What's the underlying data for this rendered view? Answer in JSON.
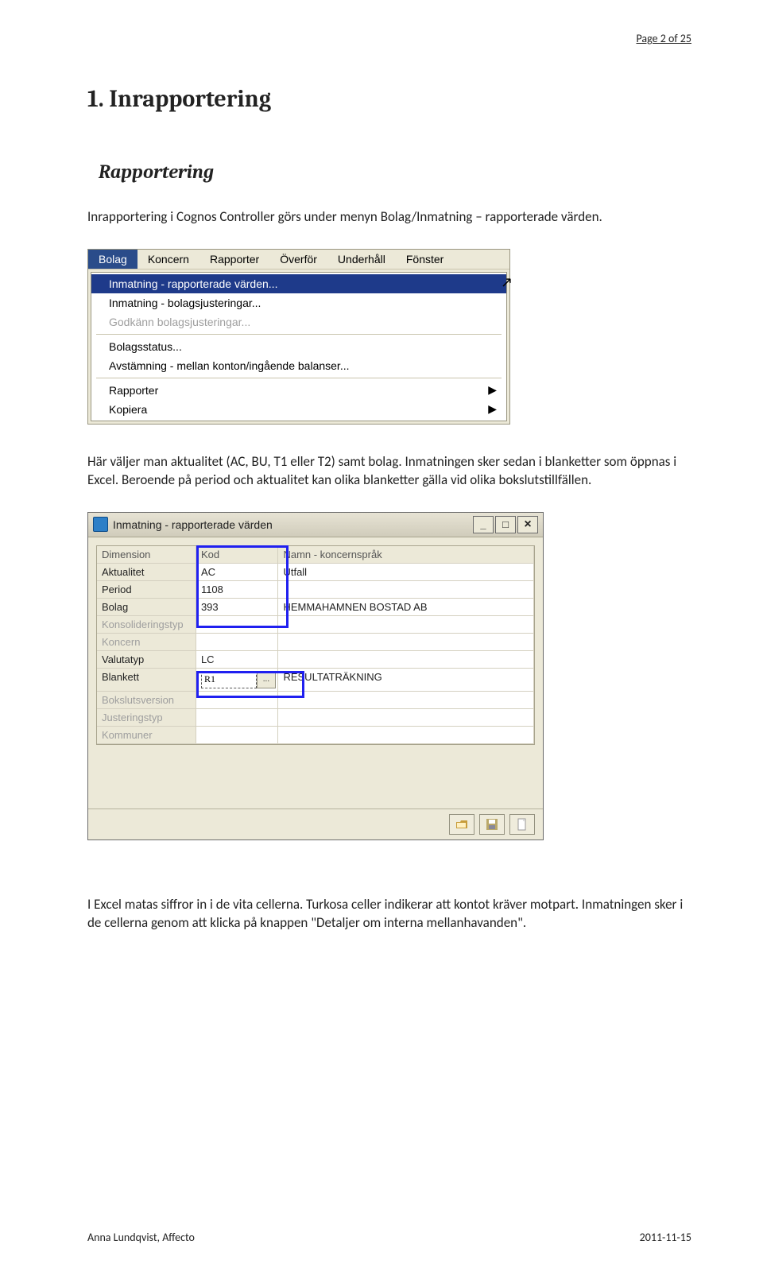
{
  "page_number_label": "Page 2 of 25",
  "heading1": "1. Inrapportering",
  "heading2": "Rapportering",
  "intro": "Inrapportering i Cognos Controller görs under menyn Bolag/Inmatning – rapporterade värden.",
  "menu": {
    "bar": [
      "Bolag",
      "Koncern",
      "Rapporter",
      "Överför",
      "Underhåll",
      "Fönster"
    ],
    "items": [
      {
        "label": "Inmatning - rapporterade värden...",
        "hl": true
      },
      {
        "label": "Inmatning - bolagsjusteringar..."
      },
      {
        "label": "Godkänn bolagsjusteringar...",
        "dis": true
      },
      {
        "sep": true
      },
      {
        "label": "Bolagsstatus..."
      },
      {
        "label": "Avstämning - mellan konton/ingående balanser..."
      },
      {
        "sep": true
      },
      {
        "label": "Rapporter",
        "caret": true
      },
      {
        "label": "Kopiera",
        "caret": true
      }
    ]
  },
  "para2": "Här väljer man aktualitet (AC, BU, T1 eller T2) samt bolag. Inmatningen sker sedan i blanketter som öppnas i Excel. Beroende på period och aktualitet kan olika blanketter gälla vid olika bokslutstillfällen.",
  "dialog": {
    "title": "Inmatning - rapporterade värden",
    "headers": {
      "c1": "Dimension",
      "c2": "Kod",
      "c3": "Namn - koncernspråk"
    },
    "rows": [
      {
        "c1": "Aktualitet",
        "c2": "AC",
        "c3": "Utfall"
      },
      {
        "c1": "Period",
        "c2": "1108",
        "c3": ""
      },
      {
        "c1": "Bolag",
        "c2": "393",
        "c3": "HEMMAHAMNEN BOSTAD AB"
      },
      {
        "c1": "Konsolideringstyp",
        "c2": "",
        "c3": "",
        "dis": true
      },
      {
        "c1": "Koncern",
        "c2": "",
        "c3": "",
        "dis": true
      },
      {
        "c1": "Valutatyp",
        "c2": "LC",
        "c3": ""
      },
      {
        "c1": "Blankett",
        "c2": "R1",
        "c3": "RESULTATRÄKNING",
        "lookup": true
      },
      {
        "c1": "Bokslutsversion",
        "c2": "",
        "c3": "",
        "dis": true
      },
      {
        "c1": "Justeringstyp",
        "c2": "",
        "c3": "",
        "dis": true
      },
      {
        "c1": "Kommuner",
        "c2": "",
        "c3": "",
        "dis": true
      }
    ],
    "lookup_btn": "...",
    "win": {
      "min": "_",
      "max": "□",
      "close": "×"
    }
  },
  "para3a": "I Excel matas siffror in i de vita cellerna. Turkosa celler indikerar att kontot kräver motpart. Inmatningen sker i de cellerna genom att klicka på knappen \"Detaljer om interna mellanhavanden\".",
  "footer_left": "Anna Lundqvist, Affecto",
  "footer_right": "2011-11-15"
}
